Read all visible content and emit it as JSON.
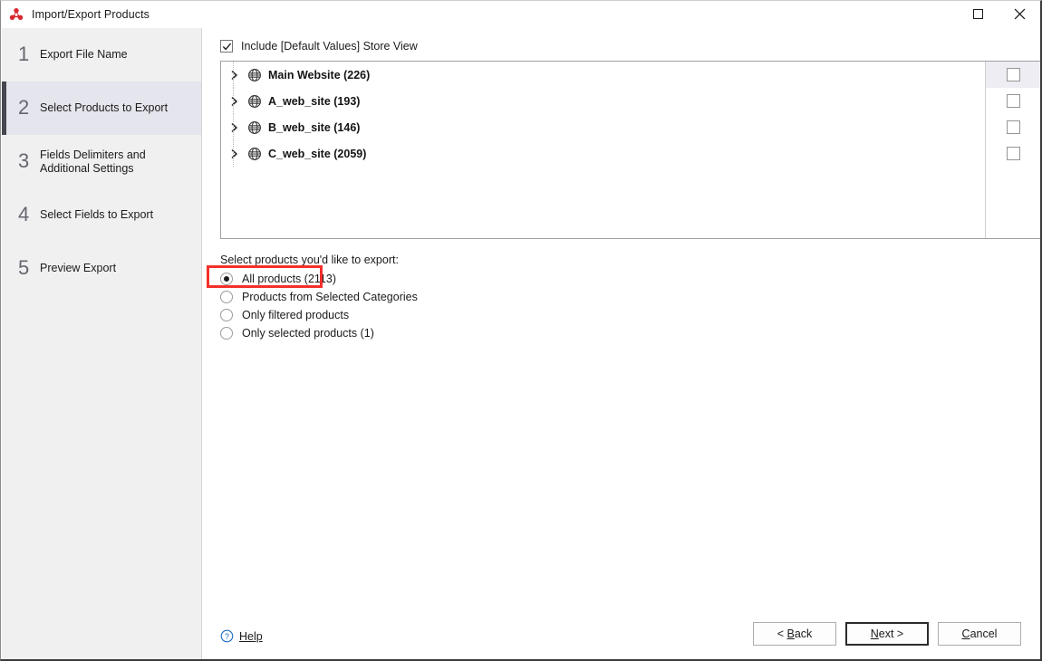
{
  "window": {
    "title": "Import/Export Products",
    "app_icon": "app-logo-icon",
    "controls": {
      "maximize": "maximize-icon",
      "close": "close-icon"
    }
  },
  "sidebar": {
    "steps": [
      {
        "num": "1",
        "label": "Export File Name",
        "active": false
      },
      {
        "num": "2",
        "label": "Select Products to Export",
        "active": true
      },
      {
        "num": "3",
        "label": "Fields Delimiters and Additional Settings",
        "active": false
      },
      {
        "num": "4",
        "label": "Select Fields to Export",
        "active": false
      },
      {
        "num": "5",
        "label": "Preview Export",
        "active": false
      }
    ]
  },
  "main": {
    "include_default_values": {
      "label": "Include [Default Values] Store View",
      "checked": true
    },
    "tree": {
      "rows": [
        {
          "label": "Main Website (226)",
          "icon": "globe-icon",
          "expander": "chevron-right-icon",
          "checked": false,
          "highlighted": true
        },
        {
          "label": "A_web_site (193)",
          "icon": "globe-icon",
          "expander": "chevron-right-icon",
          "checked": false,
          "highlighted": false
        },
        {
          "label": "B_web_site (146)",
          "icon": "globe-icon",
          "expander": "chevron-right-icon",
          "checked": false,
          "highlighted": false
        },
        {
          "label": "C_web_site (2059)",
          "icon": "globe-icon",
          "expander": "chevron-right-icon",
          "checked": false,
          "highlighted": false
        }
      ]
    },
    "radio_caption": "Select products you'd like to export:",
    "radio_options": [
      {
        "label": "All products (2113)",
        "selected": true
      },
      {
        "label": "Products from Selected Categories",
        "selected": false
      },
      {
        "label": "Only filtered products",
        "selected": false
      },
      {
        "label": "Only selected products (1)",
        "selected": false
      }
    ],
    "annotation": {
      "type": "red-highlight-rectangle",
      "target": "All products (2113)",
      "color": "#f4302b"
    }
  },
  "footer": {
    "help": {
      "label": "Help",
      "icon": "help-circle-icon"
    },
    "buttons": [
      {
        "label": "< Back",
        "mnemonic": "B",
        "default": false
      },
      {
        "label": "Next >",
        "mnemonic": "N",
        "default": true
      },
      {
        "label": "Cancel",
        "mnemonic": "C",
        "default": false
      }
    ]
  }
}
